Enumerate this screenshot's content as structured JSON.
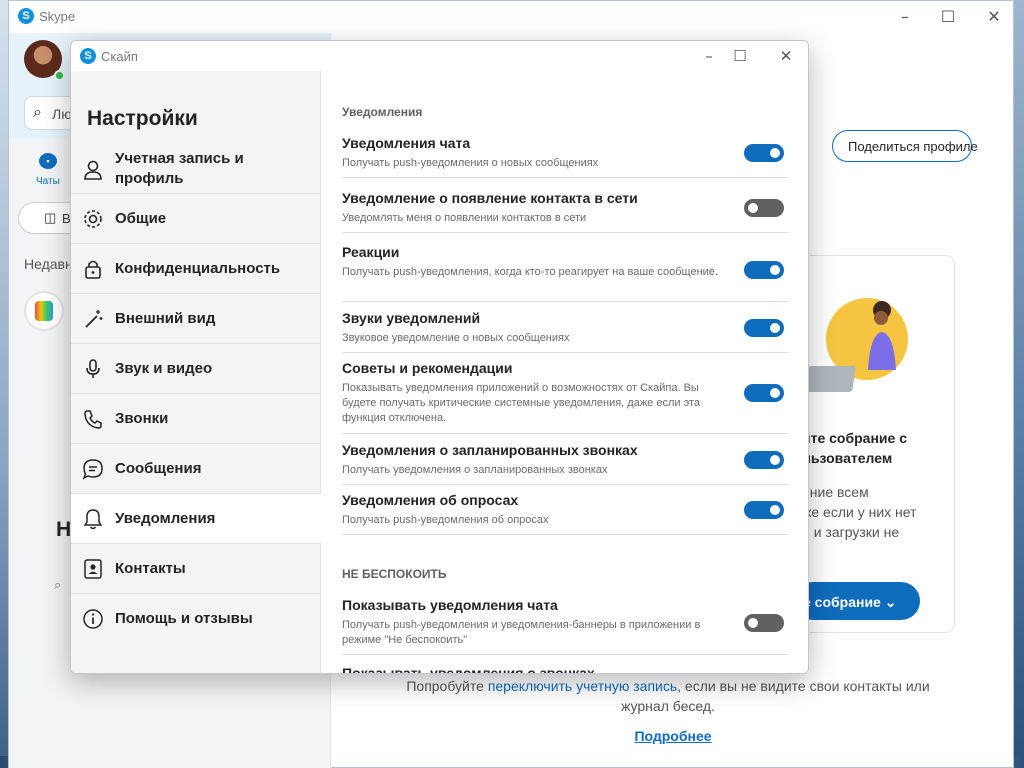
{
  "main_window": {
    "title": "Skype",
    "left": {
      "search_text": "Лю",
      "chats_label": "Чаты",
      "meet_partial": "В",
      "recent_partial": "Недавн",
      "new_heading_partial": "Н"
    },
    "right": {
      "exclamation": "!",
      "share_button": "Поделиться профиле",
      "card": {
        "title_line1": "йте собрание с",
        "title_line2": "льзователем",
        "text_line1": "ение всем",
        "text_line2": "же если у них нет",
        "text_line3": "и и загрузки не",
        "button": "е собрание ⌄"
      },
      "bottom_pre": "Попробуйте ",
      "bottom_link": "переключить учетную запись",
      "bottom_post": ", если вы не видите свои контакты или",
      "bottom_line2": "журнал бесед.",
      "more_link": "Подробнее"
    }
  },
  "dialog": {
    "title": "Скайп",
    "heading": "Настройки",
    "sidebar": [
      {
        "label": "Учетная запись и профиль",
        "label1": "Учетная запись и",
        "label2": "профиль",
        "icon": "person-icon"
      },
      {
        "label": "Общие",
        "icon": "gear-icon"
      },
      {
        "label": "Конфиденциальность",
        "icon": "lock-icon"
      },
      {
        "label": "Внешний вид",
        "icon": "magic-wand-icon"
      },
      {
        "label": "Звук и видео",
        "icon": "microphone-icon"
      },
      {
        "label": "Звонки",
        "icon": "phone-icon"
      },
      {
        "label": "Сообщения",
        "icon": "chat-bubble-icon"
      },
      {
        "label": "Уведомления",
        "icon": "bell-icon",
        "active": true
      },
      {
        "label": "Контакты",
        "icon": "contact-card-icon"
      },
      {
        "label": "Помощь и отзывы",
        "icon": "info-icon"
      }
    ],
    "section_notifications": "Уведомления",
    "notifications": [
      {
        "title": "Уведомления чата",
        "desc": "Получать push-уведомления о новых сообщениях",
        "on": true
      },
      {
        "title": "Уведомление о появление контакта в сети",
        "desc": "Уведомлять меня о появлении контактов в сети",
        "on": false
      },
      {
        "title": "Реакции",
        "desc": "Получать push-уведомления, когда кто-то реагирует на ваше сообщение.",
        "on": true
      },
      {
        "title": "Звуки уведомлений",
        "desc": "Звуковое уведомление о новых сообщениях",
        "on": true
      },
      {
        "title": "Советы и рекомендации",
        "desc": "Показывать уведомления приложений о возможностях от Скайпа. Вы будете получать критические системные уведомления, даже если эта функция отключена.",
        "on": true
      },
      {
        "title": "Уведомления о запланированных звонках",
        "desc": "Получать уведомления о запланированных звонках",
        "on": true
      },
      {
        "title": "Уведомления об опросах",
        "desc": "Получать push-уведомления об опросах",
        "on": true
      }
    ],
    "section_dnd": "НЕ БЕСПОКОИТЬ",
    "dnd": [
      {
        "title": "Показывать уведомления чата",
        "desc": "Получать push-уведомления и уведомления-баннеры в приложении в режиме \"Не беспокоить\"",
        "on": false
      },
      {
        "title": "Показывать уведомления о звонках",
        "desc": "",
        "on": false
      }
    ]
  },
  "colors": {
    "accent": "#0f6cbd",
    "toggle_off": "#616161",
    "skype_blue": "#0f8fdc"
  }
}
